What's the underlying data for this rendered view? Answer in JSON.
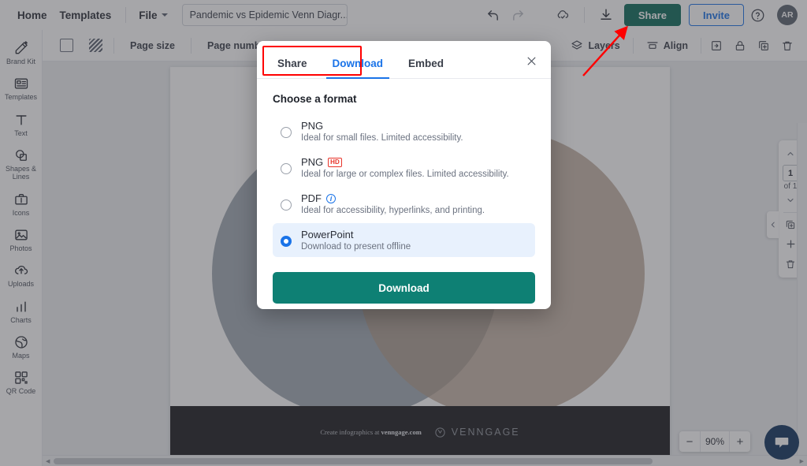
{
  "header": {
    "home": "Home",
    "templates": "Templates",
    "file": "File",
    "doc_title": "Pandemic vs Epidemic Venn Diagr...",
    "share_label": "Share",
    "invite_label": "Invite",
    "avatar_initials": "AR",
    "share_color": "#0e6b5c",
    "invite_color": "#1a73e8"
  },
  "toolbar": {
    "page_size": "Page size",
    "page_number": "Page number",
    "layers": "Layers",
    "align": "Align"
  },
  "sidebar": {
    "items": [
      {
        "label": "Brand Kit",
        "icon": "magic-wand-icon"
      },
      {
        "label": "Templates",
        "icon": "templates-icon"
      },
      {
        "label": "Text",
        "icon": "text-icon"
      },
      {
        "label": "Shapes & Lines",
        "icon": "shapes-icon"
      },
      {
        "label": "Icons",
        "icon": "icons-icon"
      },
      {
        "label": "Photos",
        "icon": "photos-icon"
      },
      {
        "label": "Uploads",
        "icon": "uploads-icon"
      },
      {
        "label": "Charts",
        "icon": "charts-icon"
      },
      {
        "label": "Maps",
        "icon": "maps-icon"
      },
      {
        "label": "QR Code",
        "icon": "qr-code-icon"
      }
    ]
  },
  "canvas": {
    "footer_text_prefix": "Create infographics at ",
    "footer_text_link": "venngage.com",
    "brand": "VENNGAGE",
    "venn": {
      "left_circle_color": "#8e99a4",
      "right_circle_color": "#b09a88"
    }
  },
  "page_rail": {
    "page_number": "1",
    "page_total": "of 1"
  },
  "zoom": {
    "value": "90%",
    "minus": "−",
    "plus": "+"
  },
  "modal": {
    "tabs": [
      {
        "label": "Share",
        "active": false
      },
      {
        "label": "Download",
        "active": true
      },
      {
        "label": "Embed",
        "active": false
      }
    ],
    "heading": "Choose a format",
    "formats": [
      {
        "name": "PNG",
        "description": "Ideal for small files. Limited accessibility.",
        "selected": false,
        "badge": "",
        "info": false
      },
      {
        "name": "PNG",
        "description": "Ideal for large or complex files. Limited accessibility.",
        "selected": false,
        "badge": "HD",
        "info": false
      },
      {
        "name": "PDF",
        "description": "Ideal for accessibility, hyperlinks, and printing.",
        "selected": false,
        "badge": "",
        "info": true
      },
      {
        "name": "PowerPoint",
        "description": "Download to present offline",
        "selected": true,
        "badge": "",
        "info": false
      }
    ],
    "download_button": "Download",
    "download_color": "#0e8074"
  },
  "annotations": {
    "highlight_color": "#ff0000"
  }
}
